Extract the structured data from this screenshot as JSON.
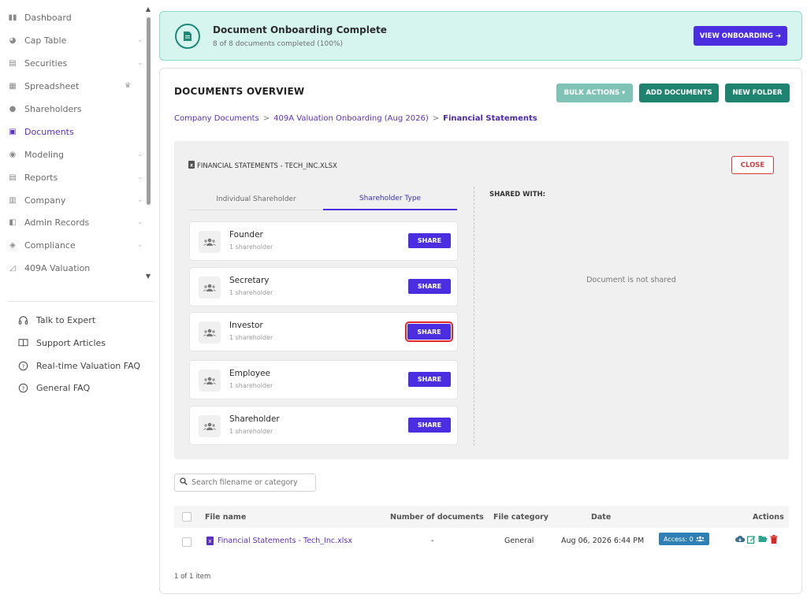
{
  "sidebar": {
    "items": [
      {
        "label": "Dashboard",
        "icon": "dashboard-icon",
        "glyph": "▮▮",
        "chevron": "",
        "active": false
      },
      {
        "label": "Cap Table",
        "icon": "pie-chart-icon",
        "glyph": "◕",
        "chevron": "⌄",
        "active": false
      },
      {
        "label": "Securities",
        "icon": "clipboard-icon",
        "glyph": "▤",
        "chevron": "⌄",
        "active": false
      },
      {
        "label": "Spreadsheet",
        "icon": "table-icon",
        "glyph": "▦",
        "chevron": "♛",
        "active": false
      },
      {
        "label": "Shareholders",
        "icon": "user-icon",
        "glyph": "●",
        "chevron": "",
        "active": false
      },
      {
        "label": "Documents",
        "icon": "folder-icon",
        "glyph": "▣",
        "chevron": "",
        "active": true
      },
      {
        "label": "Modeling",
        "icon": "lightbulb-icon",
        "glyph": "◉",
        "chevron": "⌄",
        "active": false
      },
      {
        "label": "Reports",
        "icon": "report-icon",
        "glyph": "▤",
        "chevron": "⌄",
        "active": false
      },
      {
        "label": "Company",
        "icon": "building-icon",
        "glyph": "▥",
        "chevron": "⌄",
        "active": false
      },
      {
        "label": "Admin Records",
        "icon": "records-icon",
        "glyph": "◧",
        "chevron": "⌄",
        "active": false
      },
      {
        "label": "Compliance",
        "icon": "shield-icon",
        "glyph": "◈",
        "chevron": "⌄",
        "active": false
      },
      {
        "label": "409A Valuation",
        "icon": "valuation-icon",
        "glyph": "◿",
        "chevron": "",
        "active": false
      }
    ],
    "help": [
      {
        "label": "Talk to Expert",
        "icon": "headset-icon",
        "glyph": "♫"
      },
      {
        "label": "Support Articles",
        "icon": "book-icon",
        "glyph": "▯▯"
      },
      {
        "label": "Real-time Valuation FAQ",
        "icon": "question-circle-icon",
        "glyph": "?"
      },
      {
        "label": "General FAQ",
        "icon": "question-circle-icon",
        "glyph": "?"
      }
    ]
  },
  "banner": {
    "title": "Document Onboarding Complete",
    "subtitle": "8 of 8 documents completed (100%)",
    "button": "VIEW ONBOARDING ➔"
  },
  "documents": {
    "title": "DOCUMENTS OVERVIEW",
    "bulk_actions": "BULK ACTIONS ▾",
    "add_documents": "ADD DOCUMENTS",
    "new_folder": "NEW FOLDER",
    "breadcrumb": [
      "Company Documents",
      "409A Valuation Onboarding (Aug 2026)",
      "Financial Statements"
    ],
    "breadcrumb_sep": ">"
  },
  "share_panel": {
    "file_label": "FINANCIAL STATEMENTS - TECH_INC.XLSX",
    "close": "CLOSE",
    "tabs": [
      "Individual Shareholder",
      "Shareholder Type"
    ],
    "active_tab": "Shareholder Type",
    "shared_with_label": "SHARED WITH:",
    "not_shared": "Document is not shared",
    "share_label": "SHARE",
    "types": [
      {
        "name": "Founder",
        "count": "1 shareholder"
      },
      {
        "name": "Secretary",
        "count": "1 shareholder"
      },
      {
        "name": "Investor",
        "count": "1 shareholder"
      },
      {
        "name": "Employee",
        "count": "1 shareholder"
      },
      {
        "name": "Shareholder",
        "count": "1 shareholder"
      }
    ]
  },
  "search": {
    "placeholder": "Search filename or category"
  },
  "table": {
    "columns": [
      "File name",
      "Number of documents",
      "File category",
      "Date",
      "Actions"
    ],
    "rows": [
      {
        "file_name": "Financial Statements - Tech_Inc.xlsx",
        "num_documents": "-",
        "category": "General",
        "date": "Aug 06, 2026 6:44 PM",
        "access": "Access: 0"
      }
    ],
    "item_count": "1 of 1 item"
  },
  "colors": {
    "primary": "#4b2ee0",
    "teal": "#1e8470",
    "link": "#5b2fc0",
    "danger": "#d43b3b",
    "access": "#2d7fb5"
  }
}
